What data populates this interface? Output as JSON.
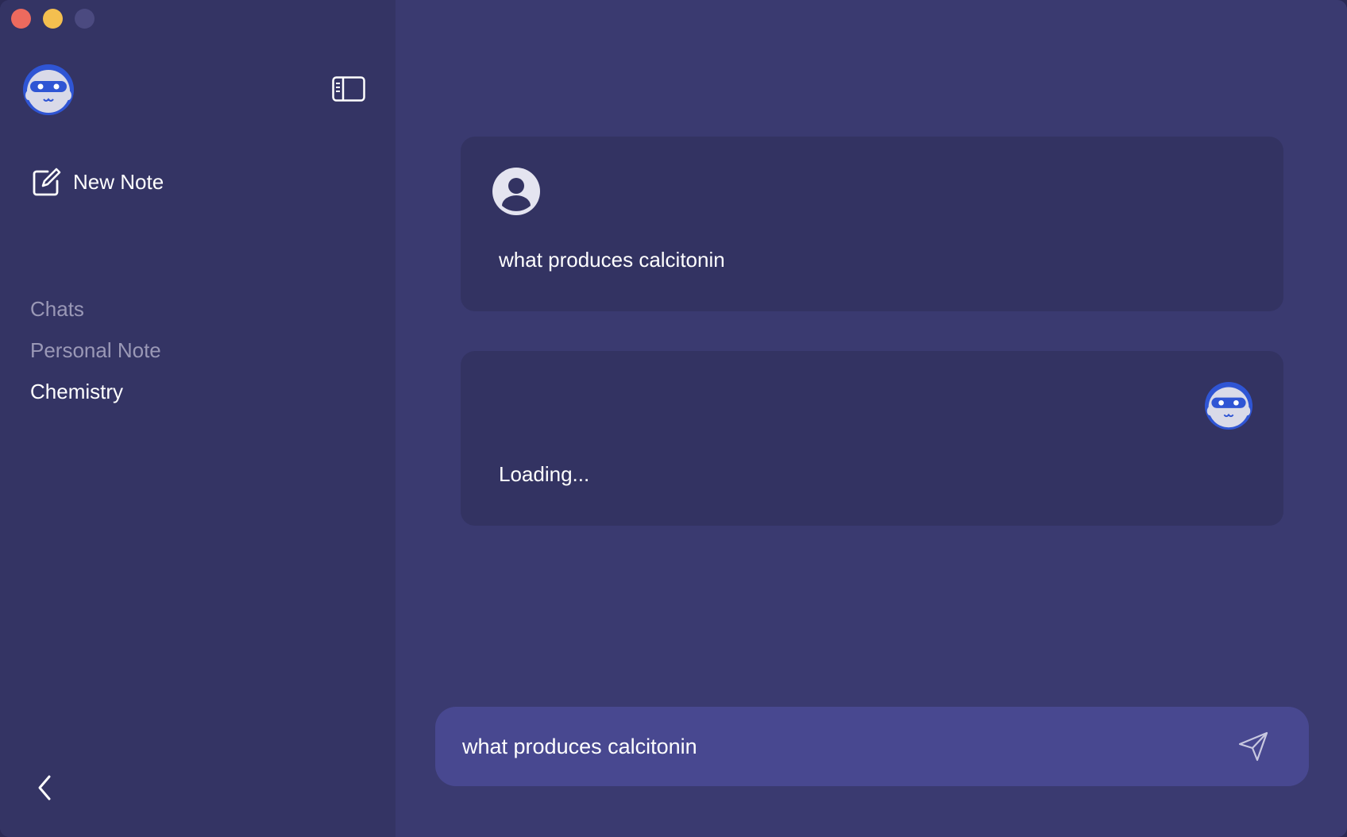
{
  "window": {
    "controls": [
      "close",
      "minimize",
      "maximize"
    ]
  },
  "sidebar": {
    "logo_icon": "robot-avatar-icon",
    "toggle_icon": "sidebar-toggle-icon",
    "new_note_label": "New Note",
    "items": [
      {
        "label": "Chats",
        "active": false
      },
      {
        "label": "Personal Note",
        "active": false
      },
      {
        "label": "Chemistry",
        "active": true
      }
    ],
    "back_icon": "chevron-left-icon"
  },
  "conversation": {
    "messages": [
      {
        "role": "user",
        "icon": "user-icon",
        "text": "what produces calcitonin"
      },
      {
        "role": "assistant",
        "icon": "robot-avatar-icon",
        "text": "Loading..."
      }
    ]
  },
  "composer": {
    "value": "what produces calcitonin",
    "send_icon": "send-icon"
  },
  "colors": {
    "background": "#3a3a70",
    "sidebar": "#343464",
    "card": "#333362",
    "input": "#484890",
    "accent": "#2f55d4"
  }
}
